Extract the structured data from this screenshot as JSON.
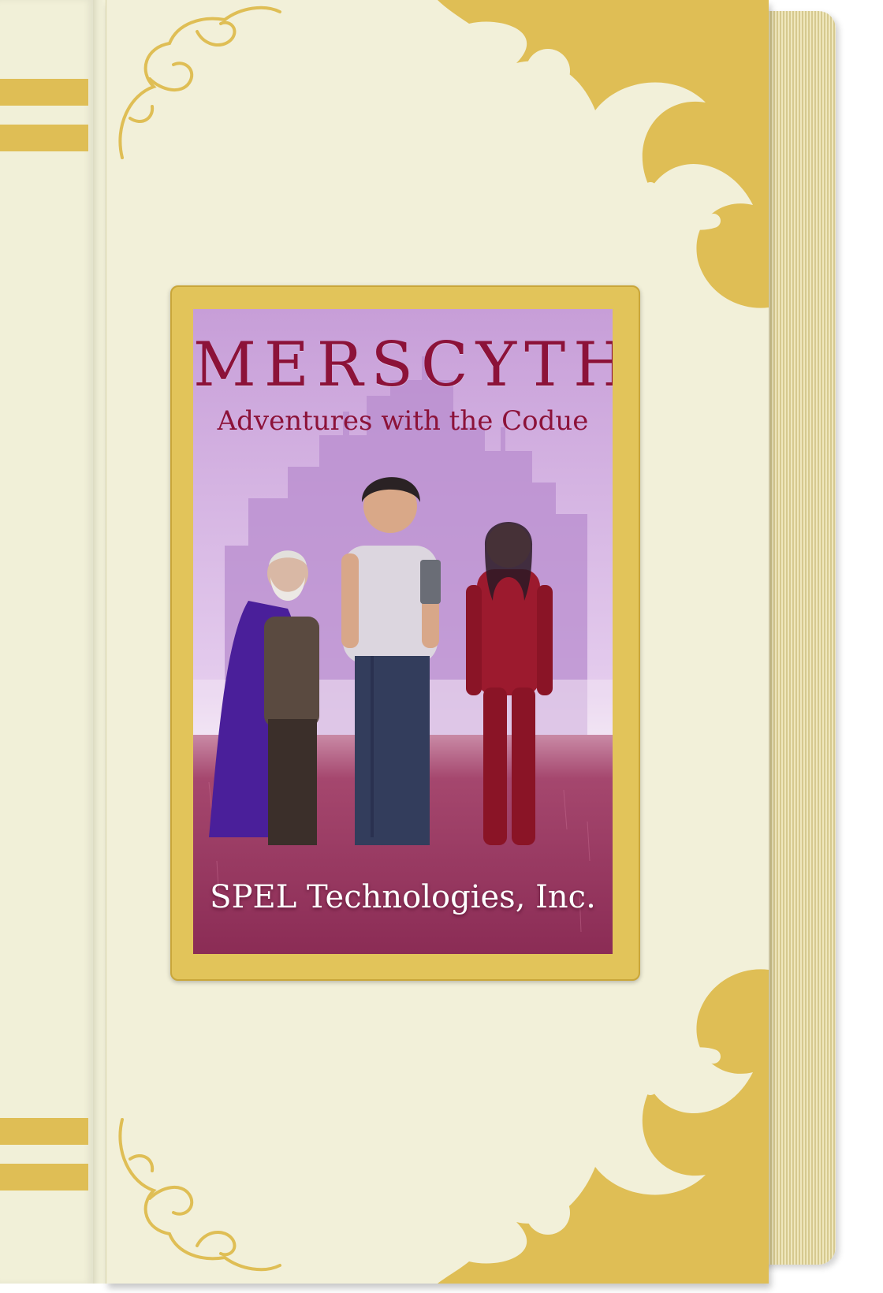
{
  "book": {
    "title": "MERSCYTHE",
    "subtitle": "Adventures with the Codue",
    "publisher": "SPEL Technologies, Inc."
  },
  "colors": {
    "cover": "#f2f0d9",
    "gold": "#dfbe55",
    "title": "#8c1239",
    "sky": "#cda8dc",
    "field": "#9c3c63"
  },
  "figures": [
    "old-elf-wizard",
    "young-man-with-tablet",
    "elf-woman-in-red-armor"
  ]
}
